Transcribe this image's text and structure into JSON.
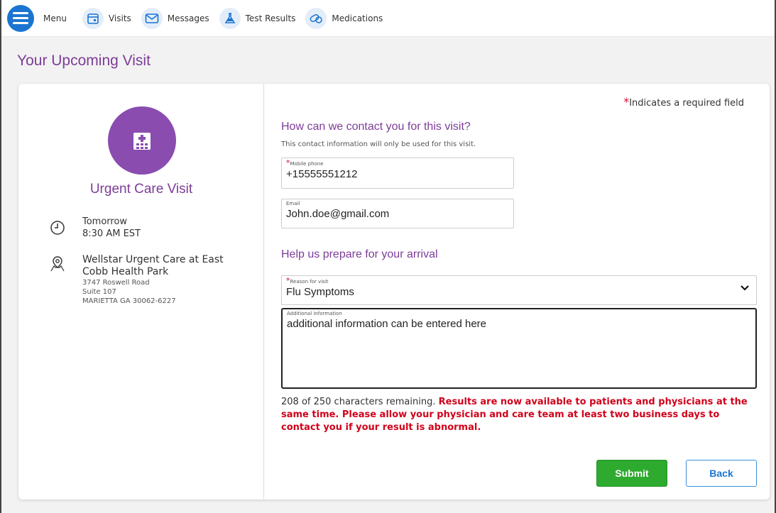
{
  "nav": {
    "menu_label": "Menu",
    "items": [
      {
        "label": "Visits",
        "icon": "calendar-icon"
      },
      {
        "label": "Messages",
        "icon": "envelope-icon"
      },
      {
        "label": "Test Results",
        "icon": "flask-icon"
      },
      {
        "label": "Medications",
        "icon": "pill-icon"
      }
    ]
  },
  "page": {
    "title": "Your Upcoming Visit"
  },
  "visit": {
    "type": "Urgent Care Visit",
    "day": "Tomorrow",
    "time": "8:30 AM EST",
    "location_name": "Wellstar Urgent Care at East Cobb Health Park",
    "address_line1": "3747 Roswell Road",
    "address_line2": "Suite 107",
    "address_line3": "MARIETTA GA 30062-6227"
  },
  "form": {
    "required_note": "Indicates a required field",
    "contact_heading": "How can we contact you for this visit?",
    "contact_note": "This contact information will only be used for this visit.",
    "phone_label": "Mobile phone",
    "phone_value": "+15555551212",
    "email_label": "Email",
    "email_value": "John.doe@gmail.com",
    "prepare_heading": "Help us prepare for your arrival",
    "reason_label": "Reason for visit",
    "reason_value": "Flu Symptoms",
    "additional_label": "Additional information",
    "additional_value": "additional information can be entered here",
    "counter_text": "208 of 250 characters remaining.",
    "notice_text": "Results are now available to patients and physicians at the same time. Please allow your physician and care team at least two business days to contact you if your result is abnormal.",
    "submit_label": "Submit",
    "back_label": "Back"
  },
  "colors": {
    "brand_purple": "#7d3c98",
    "icon_purple": "#8a4caf",
    "nav_blue": "#1b75d0",
    "submit_green": "#2eaa2e",
    "required_red": "#c8102e",
    "notice_red": "#d0021b"
  }
}
